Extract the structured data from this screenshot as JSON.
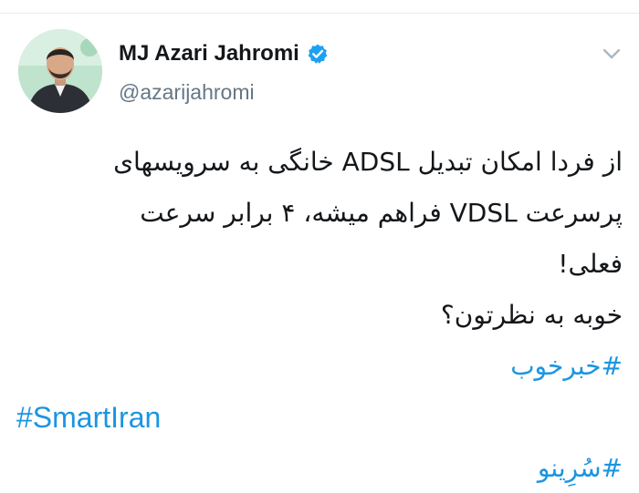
{
  "author": {
    "display_name": "MJ Azari Jahromi",
    "handle": "@azarijahromi",
    "verified": true,
    "avatar_icon": "profile-photo"
  },
  "menu": {
    "icon": "chevron-down-icon"
  },
  "tweet": {
    "lines": [
      "از فردا امکان تبدیل ADSL خانگی به سرویسهای",
      "پرسرعت VDSL فراهم میشه، ۴ برابر سرعت",
      "فعلی!",
      "خوبه به نظرتون؟"
    ],
    "hashtags": [
      "#خبرخوب",
      "#SmartIran",
      "#سُرِینو"
    ]
  },
  "colors": {
    "text": "#14171a",
    "secondary": "#657786",
    "link": "#1b95e0",
    "verified_badge": "#1da1f2",
    "divider": "#e6ecf0"
  }
}
